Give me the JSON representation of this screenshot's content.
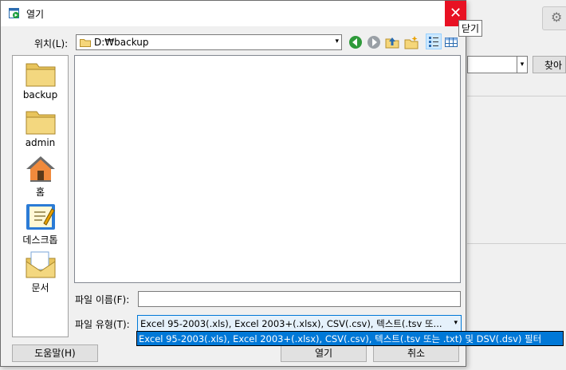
{
  "dialog": {
    "title": "열기",
    "close_tooltip": "닫기",
    "close_glyph": "✕"
  },
  "location": {
    "label": "위치(L):",
    "path": "D:₩backup",
    "arrow": "▾"
  },
  "toolbar": [
    "back-icon",
    "forward-icon",
    "up-folder-icon",
    "new-folder-icon",
    "view-list-icon",
    "view-details-icon"
  ],
  "places": [
    {
      "label": "backup",
      "icon": "folder-icon"
    },
    {
      "label": "admin",
      "icon": "folder-icon"
    },
    {
      "label": "홈",
      "icon": "home-icon"
    },
    {
      "label": "데스크톱",
      "icon": "desktop-icon"
    },
    {
      "label": "문서",
      "icon": "documents-icon"
    }
  ],
  "filename": {
    "label": "파일 이름(F):",
    "value": ""
  },
  "filetype": {
    "label": "파일 유형(T):",
    "selected": "Excel 95-2003(.xls), Excel 2003+(.xlsx), CSV(.csv), 텍스트(.tsv 또...",
    "arrow": "▾",
    "options": [
      "Excel 95-2003(.xls), Excel 2003+(.xlsx), CSV(.csv), 텍스트(.tsv 또는 .txt) 및 DSV(.dsv) 필터"
    ]
  },
  "buttons": {
    "help": "도움말(H)",
    "open": "열기",
    "cancel": "취소"
  },
  "background": {
    "find_button": "찾아",
    "dropdown_arrow": "▾",
    "gear_glyph": "⚙"
  },
  "colors": {
    "close_red": "#e81123",
    "selection_blue": "#0078d7",
    "folder_yellow": "#e8c45c"
  }
}
